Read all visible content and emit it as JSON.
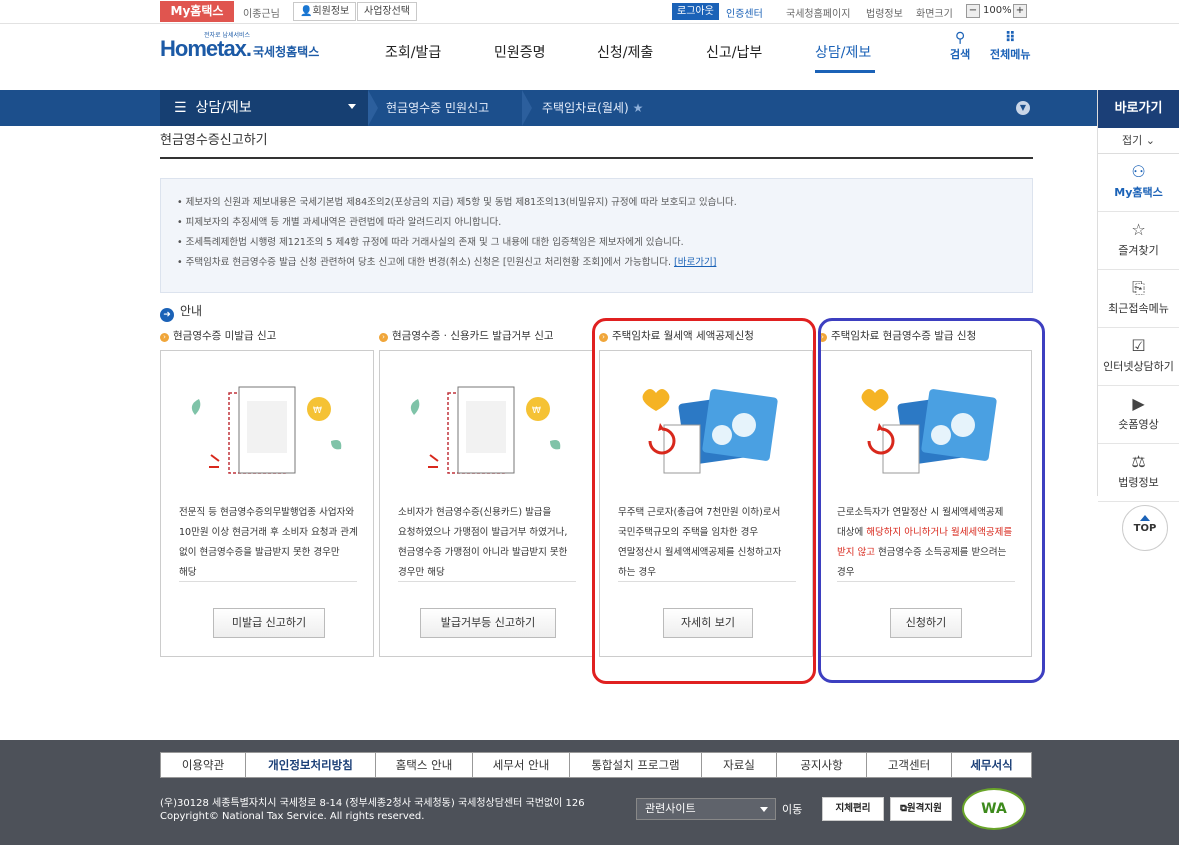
{
  "utility": {
    "my_hometax": "My홈택스",
    "user_name": "이종근님",
    "member_info": "회원정보",
    "business_select": "사업장선택",
    "logout": "로그아웃",
    "cert_center": "인증센터",
    "nts_homepage": "국세청홈페이지",
    "law_info": "법령정보",
    "screen_size": "화면크기",
    "zoom_minus": "−",
    "zoom": "100%",
    "zoom_plus": "+"
  },
  "header": {
    "logo_main": "Hometax.",
    "logo_sub": "국세청홈택스",
    "logo_tag": "전자로 납세서비스",
    "menu": [
      "조회/발급",
      "민원증명",
      "신청/제출",
      "신고/납부",
      "상담/제보"
    ],
    "active_menu": "상담/제보",
    "search": "검색",
    "all_menu": "전체메뉴"
  },
  "navbar": {
    "section": "상담/제보",
    "crumb1": "현금영수증 민원신고",
    "crumb2": "주택임차료(월세)"
  },
  "quick": {
    "title": "바로가기",
    "fold": "접기",
    "items": [
      "My홈택스",
      "즐겨찾기",
      "최근접속메뉴",
      "인터넷상담하기",
      "숏폼영상",
      "법령정보"
    ],
    "top": "TOP"
  },
  "page": {
    "title": "현금영수증신고하기",
    "notices": [
      "제보자의 신원과 제보내용은 국세기본법 제84조의2(포상금의 지급) 제5항 및 동법 제81조의13(비밀유지) 규정에 따라 보호되고 있습니다.",
      "피제보자의 추징세액 등 개별 과세내역은 관련법에 따라 알려드리지 아니합니다.",
      "조세특례제한법 시행령 제121조의 5 제4항 규정에 따라 거래사실의 존재 및 그 내용에 대한 입증책임은 제보자에게 있습니다.",
      "주택임차료 현금영수증 발급 신청 관련하여 당초 신고에 대한 변경(취소) 신청은 [민원신고 처리현황 조회]에서 가능합니다."
    ],
    "notice_link": "[바로가기]",
    "guide": "안내"
  },
  "cards": [
    {
      "title": "현금영수증 미발급 신고",
      "desc": "전문직 등 현금영수증의무발행업종 사업자와 10만원 이상 현금거래 후 소비자 요청과 관계 없이 현금영수증을 발급받지 못한 경우만 해당",
      "button": "미발급 신고하기"
    },
    {
      "title": "현금영수증 · 신용카드 발급거부 신고",
      "desc": "소비자가 현금영수증(신용카드) 발급을 요청하였으나 가맹점이 발급거부 하였거나, 현금영수증 가맹점이 아니라 발급받지 못한 경우만 해당",
      "button": "발급거부등 신고하기"
    },
    {
      "title": "주택임차료 월세액 세액공제신청",
      "desc": "무주택 근로자(총급여 7천만원 이하)로서 국민주택규모의 주택을 임차한 경우 연말정산시 월세액세액공제를 신청하고자 하는 경우",
      "button": "자세히 보기"
    },
    {
      "title": "주택임차료 현금영수증 발급 신청",
      "desc_a": "근로소득자가 연말정산 시 월세액세액공제 대상에 ",
      "desc_red": "해당하지 아니하거나 월세세액공제를 받지 않고",
      "desc_b": " 현금영수증 소득공제를 받으려는 경우",
      "button": "신청하기"
    }
  ],
  "footer": {
    "nav": [
      "이용약관",
      "개인정보처리방침",
      "홈택스 안내",
      "세무서 안내",
      "통합설치 프로그램",
      "자료실",
      "공지사항",
      "고객센터",
      "세무서식"
    ],
    "address": "(우)30128 세종특별자치시 국세청로 8-14 (정부세종2청사 국세청동) 국세청상담센터 국번없이 126",
    "copyright": "Copyright© National Tax Service. All rights reserved.",
    "related": "관련사이트",
    "go": "이동",
    "badge1": "지체편리",
    "badge2": "원격지원",
    "wa": "WA"
  },
  "colors": {
    "brand_blue": "#1b62b7",
    "nav_blue": "#1c4f8c",
    "highlight_red": "#e02020",
    "highlight_blue": "#3d3fc0",
    "my_badge": "#e0554f"
  }
}
